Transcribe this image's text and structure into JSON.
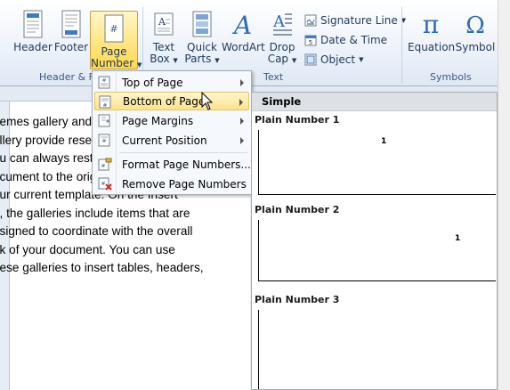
{
  "ribbon": {
    "buttons": {
      "header": "Header",
      "footer": "Footer",
      "page_number_1": "Page",
      "page_number_2": "Number",
      "text_box_1": "Text",
      "text_box_2": "Box",
      "quick_parts_1": "Quick",
      "quick_parts_2": "Parts",
      "wordart": "WordArt",
      "drop_cap_1": "Drop",
      "drop_cap_2": "Cap",
      "signature_line": "Signature Line",
      "date_time": "Date & Time",
      "object": "Object",
      "equation": "Equation",
      "symbol": "Symbol"
    },
    "groups": {
      "header_footer": "Header & F",
      "text": "Text",
      "symbols": "Symbols"
    }
  },
  "menu": {
    "items": [
      {
        "label": "Top of Page",
        "icon": "page-top-icon",
        "submenu": true
      },
      {
        "label": "Bottom of Page",
        "icon": "page-bottom-icon",
        "submenu": true,
        "highlighted": true
      },
      {
        "label": "Page Margins",
        "icon": "page-margins-icon",
        "submenu": true
      },
      {
        "label": "Current Position",
        "icon": "current-position-icon",
        "submenu": true
      },
      {
        "label": "Format Page Numbers...",
        "icon": "format-page-numbers-icon",
        "submenu": false
      },
      {
        "label": "Remove Page Numbers",
        "icon": "remove-page-numbers-icon",
        "submenu": false
      }
    ]
  },
  "gallery": {
    "section": "Simple",
    "items": [
      {
        "title": "Plain Number 1",
        "number": "1",
        "align": "center"
      },
      {
        "title": "Plain Number 2",
        "number": "1",
        "align": "right"
      },
      {
        "title": "Plain Number 3",
        "number": "",
        "align": ""
      }
    ]
  },
  "document": {
    "lines": [
      "hemes gallery and the Quick Styles",
      "allery provide reset commands so that",
      "ou can always restore the look of your",
      "ocument to the original contained in",
      "our current template. On the Insert",
      "b, the galleries include items that are",
      "esigned to coordinate with the overall",
      "ok of your document. You can use",
      "nese galleries to insert tables, headers,"
    ]
  },
  "colors": {
    "ribbon_text": "#1e395b",
    "highlight": "#ffe38a",
    "remove_icon_red": "#d9261c"
  }
}
